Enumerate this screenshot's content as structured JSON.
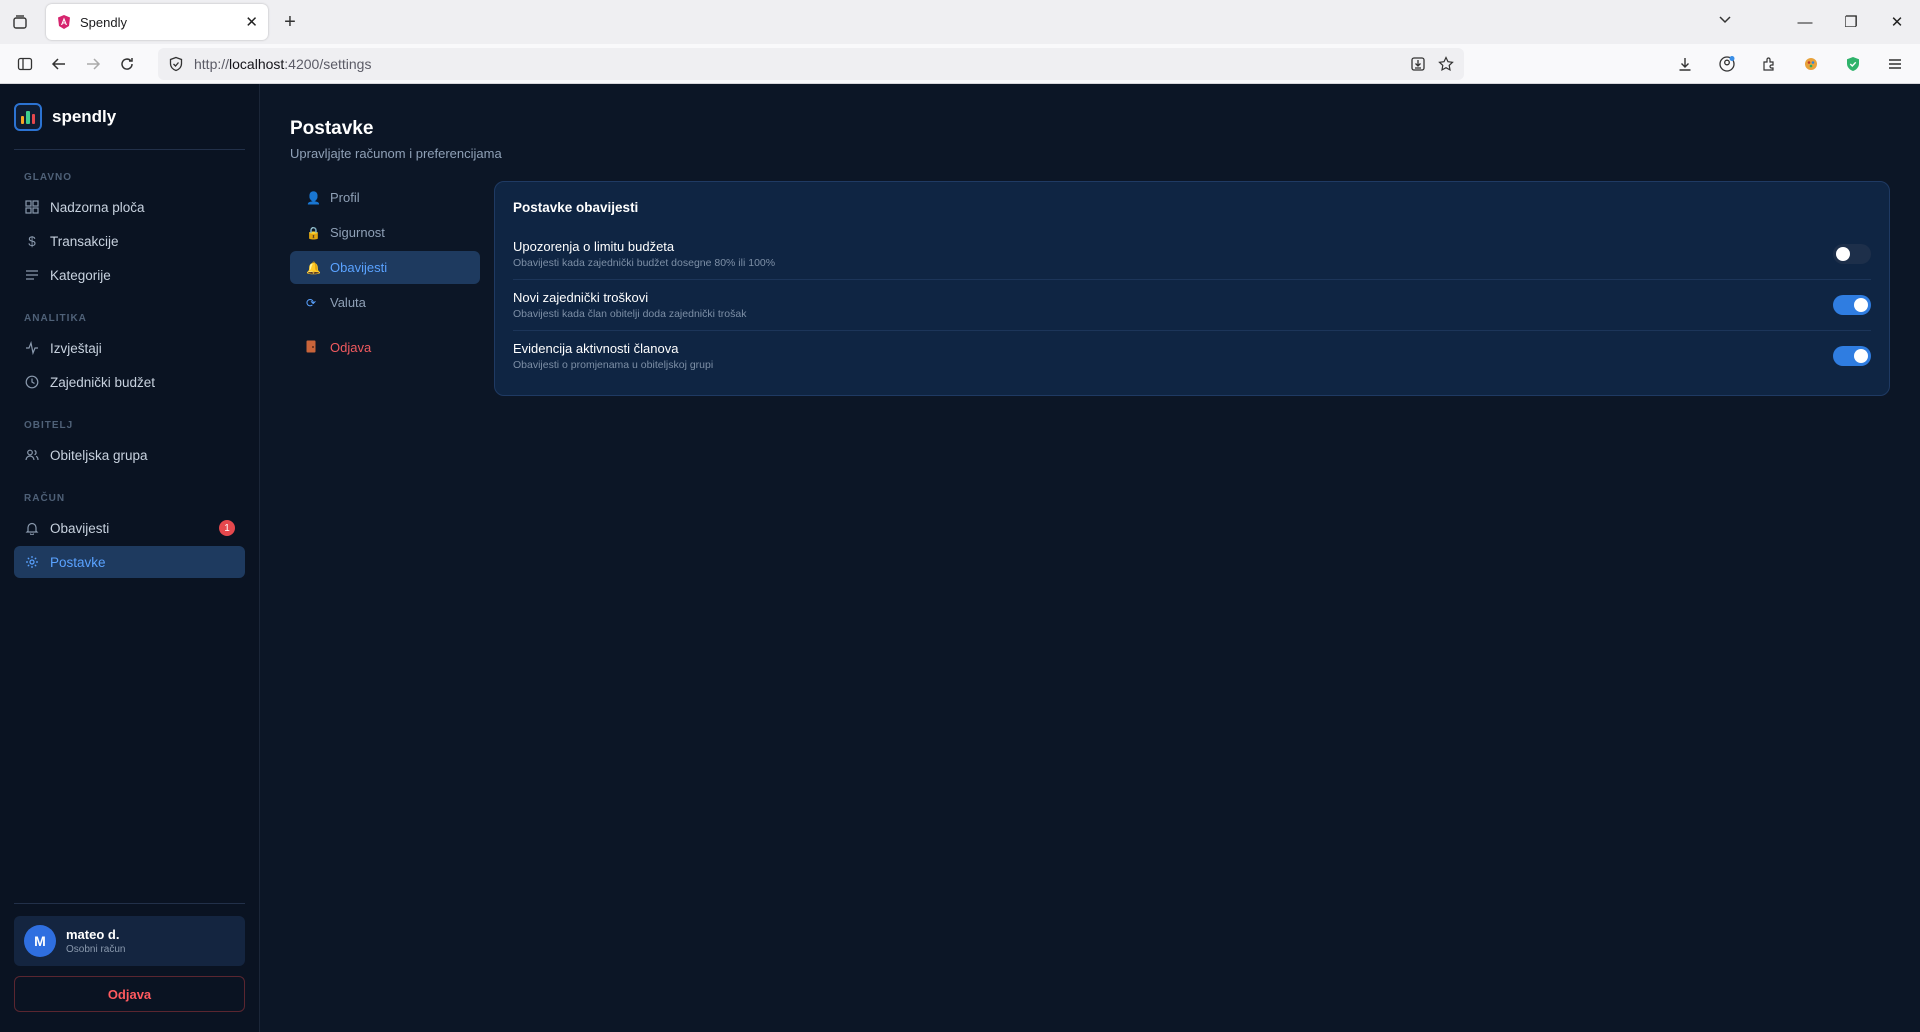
{
  "browser": {
    "tab_title": "Spendly",
    "url_prefix": "http://",
    "url_host": "localhost",
    "url_rest": ":4200/settings"
  },
  "sidebar": {
    "logo_text": "spendly",
    "sections": [
      {
        "label": "GLAVNO",
        "items": [
          "Nadzorna ploča",
          "Transakcije",
          "Kategorije"
        ]
      },
      {
        "label": "ANALITIKA",
        "items": [
          "Izvještaji",
          "Zajednički budžet"
        ]
      },
      {
        "label": "OBITELJ",
        "items": [
          "Obiteljska grupa"
        ]
      },
      {
        "label": "RAČUN",
        "items": [
          "Obavijesti",
          "Postavke"
        ]
      }
    ],
    "notif_badge": "1",
    "user": {
      "initial": "M",
      "name": "mateo d.",
      "subtitle": "Osobni račun"
    },
    "logout_label": "Odjava"
  },
  "page": {
    "title": "Postavke",
    "subtitle": "Upravljajte računom i preferencijama"
  },
  "settings_nav": [
    "Profil",
    "Sigurnost",
    "Obavijesti",
    "Valuta",
    "Odjava"
  ],
  "panel": {
    "title": "Postavke obavijesti",
    "rows": [
      {
        "title": "Upozorenja o limitu budžeta",
        "desc": "Obavijesti kada zajednički budžet dosegne 80% ili 100%",
        "enabled": false
      },
      {
        "title": "Novi zajednički troškovi",
        "desc": "Obavijesti kada član obitelji doda zajednički trošak",
        "enabled": true
      },
      {
        "title": "Evidencija aktivnosti članova",
        "desc": "Obavijesti o promjenama u obiteljskoj grupi",
        "enabled": true
      }
    ]
  },
  "colors": {
    "accent": "#2f7de1",
    "active_text": "#5aa2ff",
    "danger": "#f05a5f",
    "bg": "#0c1626"
  }
}
